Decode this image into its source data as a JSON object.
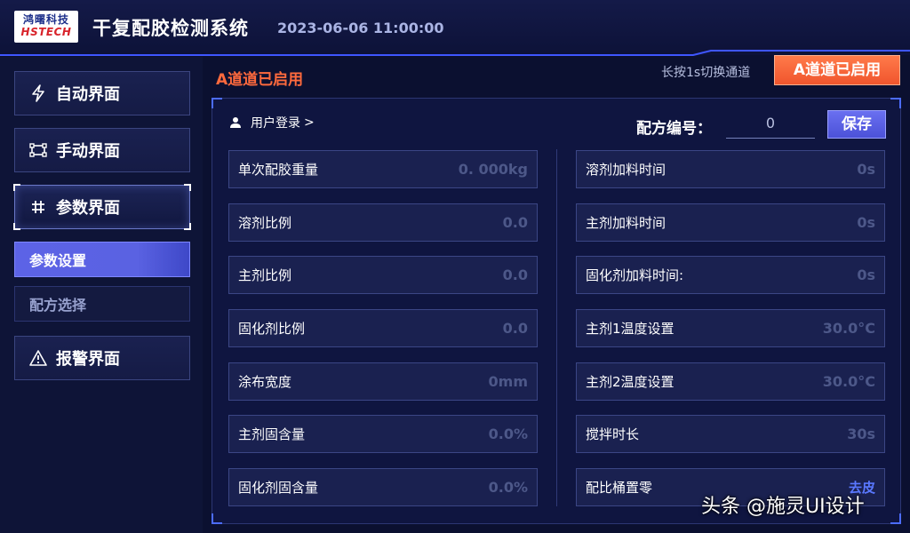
{
  "header": {
    "logo_cn": "鸿曙科技",
    "logo_en": "HSTECH",
    "title": "干复配胶检测系统",
    "datetime": "2023-06-06 11:00:00"
  },
  "sidebar": {
    "nav": [
      {
        "label": "自动界面",
        "icon": "lightning-icon"
      },
      {
        "label": "手动界面",
        "icon": "frame-icon"
      },
      {
        "label": "参数界面",
        "icon": "hash-icon"
      },
      {
        "label": "报警界面",
        "icon": "warning-icon"
      }
    ],
    "sub": [
      {
        "label": "参数设置"
      },
      {
        "label": "配方选择"
      }
    ]
  },
  "main": {
    "channel_status": "A道道已启用",
    "switch_hint": "长按1s切换通道",
    "channel_button": "A道道已启用",
    "login_label": "用户登录",
    "login_chevron": ">",
    "recipe_label": "配方编号：",
    "recipe_value": "0",
    "save_label": "保存",
    "left_fields": [
      {
        "label": "单次配胶重量",
        "value": "0. 000kg"
      },
      {
        "label": "溶剂比例",
        "value": "0.0"
      },
      {
        "label": "主剂比例",
        "value": "0.0"
      },
      {
        "label": "固化剂比例",
        "value": "0.0"
      },
      {
        "label": "涂布宽度",
        "value": "0mm"
      },
      {
        "label": "主剂固含量",
        "value": "0.0%"
      },
      {
        "label": "固化剂固含量",
        "value": "0.0%"
      }
    ],
    "right_fields": [
      {
        "label": "溶剂加料时间",
        "value": "0s"
      },
      {
        "label": "主剂加料时间",
        "value": "0s"
      },
      {
        "label": "固化剂加料时间:",
        "value": "0s"
      },
      {
        "label": "主剂1温度设置",
        "value": "30.0°C"
      },
      {
        "label": "主剂2温度设置",
        "value": "30.0°C"
      },
      {
        "label": "搅拌时长",
        "value": "30s"
      },
      {
        "label": "配比桶置零",
        "link": "去皮"
      }
    ]
  },
  "watermark": "头条 @施灵UI设计",
  "colors": {
    "background": "#0b1030",
    "accent_orange": "#f0552d",
    "accent_blue": "#5c63e6",
    "field_bg": "#1a2150"
  }
}
